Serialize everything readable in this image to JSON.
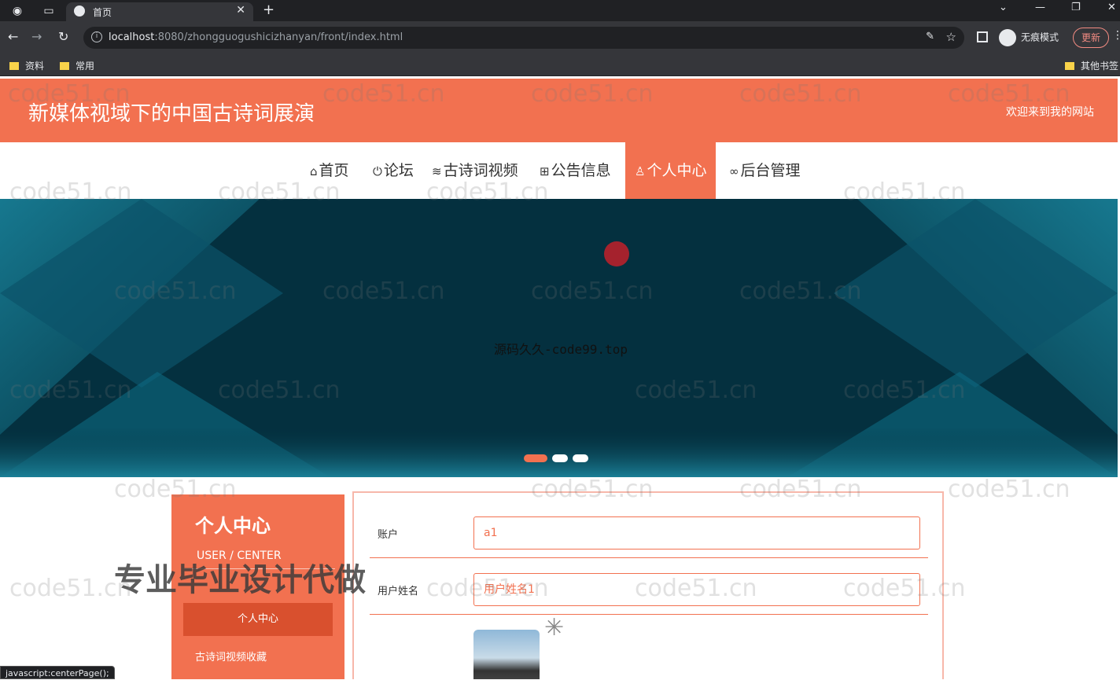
{
  "browser": {
    "tab_title": "首页",
    "url_host": "localhost",
    "url_path": ":8080/zhongguogushicizhanyan/front/index.html",
    "profile_label": "无痕模式",
    "update_label": "更新",
    "bookmarks": [
      "资料",
      "常用"
    ],
    "other_bookmarks": "其他书签",
    "status_text": "javascript:centerPage();"
  },
  "site": {
    "title": "新媒体视域下的中国古诗词展演",
    "welcome": "欢迎来到我的网站",
    "nav": [
      {
        "label": "首页",
        "icon": "home-icon"
      },
      {
        "label": "论坛",
        "icon": "power-icon"
      },
      {
        "label": "古诗词视频",
        "icon": "layers-icon"
      },
      {
        "label": "公告信息",
        "icon": "book-icon"
      },
      {
        "label": "个人中心",
        "icon": "user-icon",
        "active": true
      },
      {
        "label": "后台管理",
        "icon": "link-icon"
      }
    ]
  },
  "banner": {
    "caption": "源码久久-code99.top",
    "slides": 3,
    "active_slide": 1
  },
  "sidebar": {
    "heading": "个人中心",
    "subheading": "USER / CENTER",
    "items": [
      "个人中心",
      "古诗词视频收藏"
    ]
  },
  "promo_overlay": "专业毕业设计代做",
  "form": {
    "account_label": "账户",
    "account_value": "a1",
    "name_label": "用户姓名",
    "name_value": "用户姓名1"
  },
  "watermark_text": "code51.cn",
  "colors": {
    "accent": "#f27150",
    "banner_bg": "#04303f"
  }
}
